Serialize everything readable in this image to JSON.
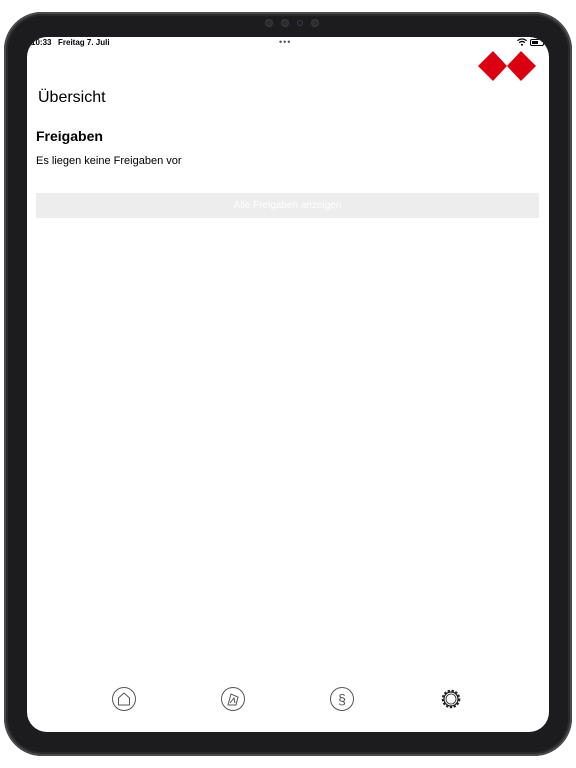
{
  "status_bar": {
    "time": "10:33",
    "date": "Freitag 7. Juli",
    "dots": "•••"
  },
  "brand": {
    "accent": "#db0011"
  },
  "page": {
    "title": "Übersicht"
  },
  "approvals": {
    "heading": "Freigaben",
    "empty_message": "Es liegen keine Freigaben vor",
    "show_all_label": "Alle Freigaben anzeigen"
  },
  "tab_bar": {
    "items": [
      {
        "icon": "home-icon"
      },
      {
        "icon": "document-sign-icon"
      },
      {
        "icon": "paragraph-icon"
      },
      {
        "icon": "gear-icon"
      }
    ]
  }
}
